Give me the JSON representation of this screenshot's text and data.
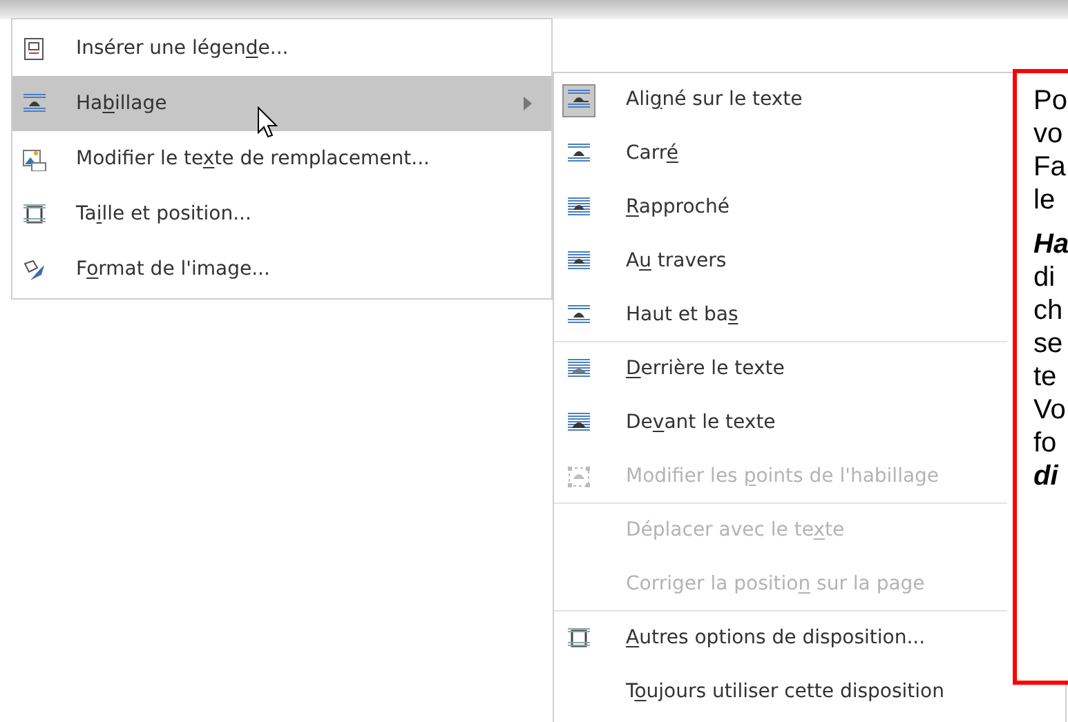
{
  "context_menu": {
    "items": [
      {
        "label": {
          "pre": "Insérer une légen",
          "key": "d",
          "post": "e..."
        },
        "kind": "caption",
        "highlighted": false,
        "has_submenu": false
      },
      {
        "label": {
          "pre": "Ha",
          "key": "b",
          "post": "illage"
        },
        "kind": "wrap",
        "highlighted": true,
        "has_submenu": true
      },
      {
        "label": {
          "pre": "Modifier le te",
          "key": "x",
          "post": "te de remplacement..."
        },
        "kind": "alt_text",
        "highlighted": false,
        "has_submenu": false
      },
      {
        "label": {
          "pre": "Ta",
          "key": "i",
          "post": "lle et position..."
        },
        "kind": "size",
        "highlighted": false,
        "has_submenu": false
      },
      {
        "label": {
          "pre": "F",
          "key": "o",
          "post": "rmat de l'image..."
        },
        "kind": "format",
        "highlighted": false,
        "has_submenu": false
      }
    ]
  },
  "submenu": {
    "items": [
      {
        "label": {
          "pre": "Ali",
          "key": "g",
          "post": "né sur le texte"
        },
        "kind": "inline",
        "selected": true,
        "disabled": false,
        "separator_after": false
      },
      {
        "label": {
          "pre": "Carr",
          "key": "é"
        },
        "kind": "square",
        "selected": false,
        "disabled": false,
        "separator_after": false
      },
      {
        "label": {
          "key": "R",
          "post": "approché"
        },
        "kind": "tight",
        "selected": false,
        "disabled": false,
        "separator_after": false
      },
      {
        "label": {
          "pre": "A",
          "key": "u",
          "post": " travers"
        },
        "kind": "through",
        "selected": false,
        "disabled": false,
        "separator_after": false
      },
      {
        "label": {
          "pre": "Haut et ba",
          "key": "s"
        },
        "kind": "topbottom",
        "selected": false,
        "disabled": false,
        "separator_after": true
      },
      {
        "label": {
          "key": "D",
          "post": "errière le texte"
        },
        "kind": "behind",
        "selected": false,
        "disabled": false,
        "separator_after": false
      },
      {
        "label": {
          "pre": "De",
          "key": "v",
          "post": "ant le texte"
        },
        "kind": "front",
        "selected": false,
        "disabled": false,
        "separator_after": false
      },
      {
        "label": {
          "pre": "Modifier les ",
          "key": "p",
          "post": "oints de l'habillage"
        },
        "kind": "points",
        "selected": false,
        "disabled": true,
        "separator_after": true
      },
      {
        "label": {
          "pre": "Déplacer avec le te",
          "key": "x",
          "post": "te"
        },
        "kind": "plain",
        "selected": false,
        "disabled": true,
        "separator_after": false
      },
      {
        "label": {
          "pre": "Corriger la positio",
          "key": "n",
          "post": " sur la page"
        },
        "kind": "plain",
        "selected": false,
        "disabled": true,
        "separator_after": true
      },
      {
        "label": {
          "key": "A",
          "post": "utres options de disposition..."
        },
        "kind": "size",
        "selected": false,
        "disabled": false,
        "separator_after": false
      },
      {
        "label": {
          "pre": "T",
          "key": "o",
          "post": "ujours utiliser cette disposition"
        },
        "kind": "plain",
        "selected": false,
        "disabled": false,
        "separator_after": false
      }
    ]
  },
  "callout": {
    "lines": [
      {
        "text": "Po",
        "emphasis": false
      },
      {
        "text": "vo",
        "emphasis": false
      },
      {
        "text": "Fa",
        "emphasis": false
      },
      {
        "text": "le",
        "emphasis": false
      },
      {
        "text": "Ha",
        "emphasis": true
      },
      {
        "text": "di",
        "emphasis": false
      },
      {
        "text": "ch",
        "emphasis": false
      },
      {
        "text": "se",
        "emphasis": false
      },
      {
        "text": "te",
        "emphasis": false
      },
      {
        "text": "Vo",
        "emphasis": false
      },
      {
        "text": "fo",
        "emphasis": false
      },
      {
        "text": "di",
        "emphasis": true
      }
    ]
  }
}
